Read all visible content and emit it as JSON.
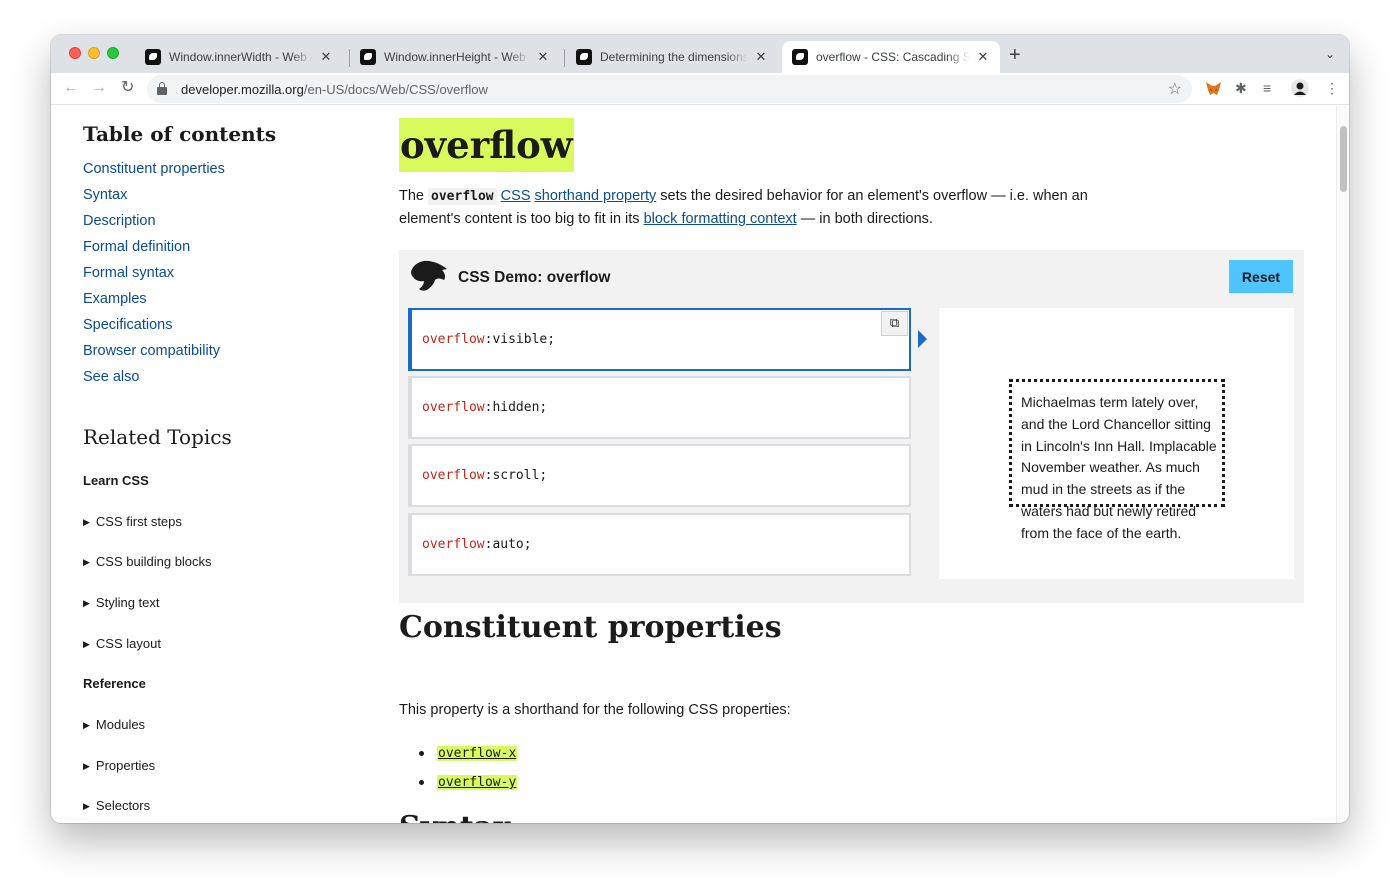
{
  "browser": {
    "tabs": [
      {
        "title": "Window.innerWidth - Web API",
        "active": false
      },
      {
        "title": "Window.innerHeight - Web API",
        "active": false
      },
      {
        "title": "Determining the dimensions of",
        "active": false
      },
      {
        "title": "overflow - CSS: Cascading Sty",
        "active": true
      }
    ],
    "new_tab": "+",
    "tab_menu": "⌄",
    "close": "✕",
    "url_host": "developer.mozilla.org",
    "url_path": "/en-US/docs/Web/CSS/overflow",
    "icons": {
      "back": "←",
      "forward": "→",
      "reload": "↻",
      "star": "☆",
      "extensions": "✱",
      "reading_list": "≡",
      "menu": "⋮"
    }
  },
  "sidebar": {
    "toc_title": "Table of contents",
    "toc_links": [
      "Constituent properties",
      "Syntax",
      "Description",
      "Formal definition",
      "Formal syntax",
      "Examples",
      "Specifications",
      "Browser compatibility",
      "See also"
    ],
    "related_title": "Related Topics",
    "learn_heading": "Learn CSS",
    "learn_items": [
      "CSS first steps",
      "CSS building blocks",
      "Styling text",
      "CSS layout"
    ],
    "reference_heading": "Reference",
    "reference_items": [
      "Modules",
      "Properties",
      "Selectors"
    ]
  },
  "main": {
    "title": "overflow",
    "intro": {
      "p1": "The ",
      "code": "overflow",
      "link_css": "CSS",
      "link_shorthand": "shorthand property",
      "p2": " sets the desired behavior for an element's overflow — i.e. when an element's content is too big to fit in its ",
      "link_bfc": "block formatting context",
      "p3": " — in both directions."
    },
    "demo": {
      "title": "CSS Demo: overflow",
      "reset_label": "Reset",
      "choices": [
        {
          "prop": "overflow",
          "value": "visible",
          "selected": true
        },
        {
          "prop": "overflow",
          "value": "hidden",
          "selected": false
        },
        {
          "prop": "overflow",
          "value": "scroll",
          "selected": false
        },
        {
          "prop": "overflow",
          "value": "auto",
          "selected": false
        }
      ],
      "copy_icon": "⧉",
      "output_text": "Michaelmas term lately over, and the Lord Chancellor sitting in Lincoln's Inn Hall. Implacable November weather. As much mud in the streets as if the waters had but newly retired from the face of the earth."
    },
    "constituent_heading": "Constituent properties",
    "constituent_text": "This property is a shorthand for the following CSS properties:",
    "constituent_links": [
      "overflow-x",
      "overflow-y"
    ],
    "syntax_heading": "Syntax"
  },
  "colors": {
    "accent_highlight": "#d9fa5d",
    "link": "#0a4d8c",
    "reset_button": "#4fc5ff",
    "code_prop": "#c2271a",
    "selected_border": "#1b6ac9"
  }
}
